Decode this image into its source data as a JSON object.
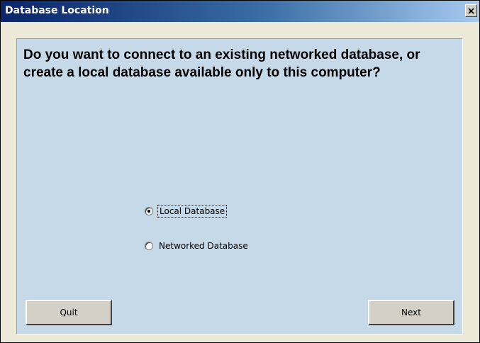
{
  "window": {
    "title": "Database Location",
    "close_icon": "close-icon"
  },
  "prompt": {
    "question": "Do you want to connect to an existing networked database, or create a local database available only to this computer?"
  },
  "options": [
    {
      "label": "Local Database",
      "selected": true
    },
    {
      "label": "Networked Database",
      "selected": false
    }
  ],
  "buttons": {
    "quit_label": "Quit",
    "next_label": "Next"
  },
  "colors": {
    "panel_background": "#c5d9e8",
    "titlebar_start": "#0a246a",
    "titlebar_end": "#a6caf0"
  }
}
